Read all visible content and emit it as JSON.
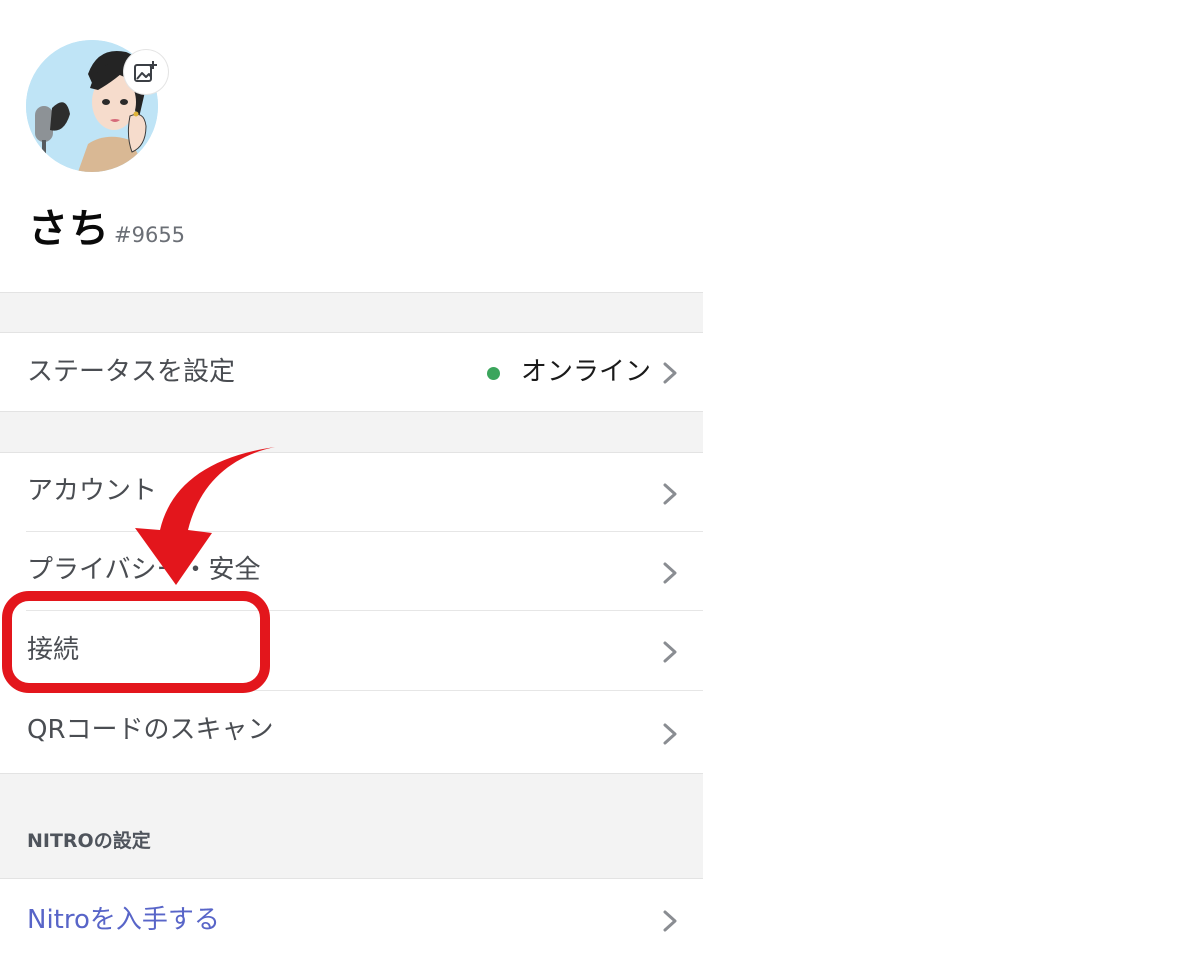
{
  "profile": {
    "username": "さち",
    "discriminator": "#9655"
  },
  "status_row": {
    "label": "ステータスを設定",
    "value": "オンライン",
    "status_color": "#3ba55c"
  },
  "settings_items": [
    {
      "label": "アカウント"
    },
    {
      "label": "プライバシー・安全"
    },
    {
      "label": "接続"
    },
    {
      "label": "QRコードのスキャン"
    }
  ],
  "nitro_section": {
    "header": "NITROの設定",
    "get_nitro_label": "Nitroを入手する"
  },
  "annotation": {
    "color": "#e3161c"
  },
  "colors": {
    "background": "#ffffff",
    "separator": "#f3f3f3",
    "link": "#5865c8"
  }
}
